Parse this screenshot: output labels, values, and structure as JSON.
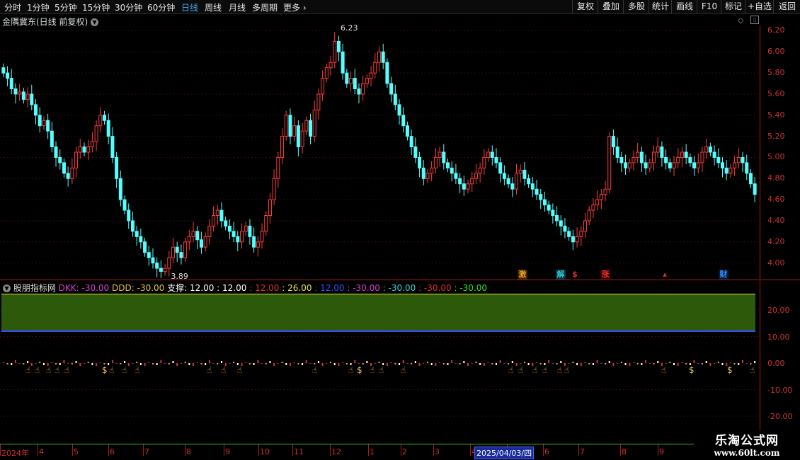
{
  "toolbar": {
    "timeframes": [
      {
        "label": "分时",
        "active": false
      },
      {
        "label": "1分钟",
        "active": false
      },
      {
        "label": "5分钟",
        "active": false
      },
      {
        "label": "15分钟",
        "active": false
      },
      {
        "label": "30分钟",
        "active": false
      },
      {
        "label": "60分钟",
        "active": false
      },
      {
        "label": "日线",
        "active": true
      },
      {
        "label": "周线",
        "active": false
      },
      {
        "label": "月线",
        "active": false
      },
      {
        "label": "多周期",
        "active": false
      },
      {
        "label": "更多",
        "active": false
      }
    ],
    "tools": [
      "复权",
      "叠加",
      "多股",
      "统计",
      "画线",
      "F10",
      "标记",
      "+自选",
      "返回"
    ]
  },
  "main_chart": {
    "title": "金隅冀东(日线 前复权)",
    "price_labels": [
      "6.20",
      "6.00",
      "5.80",
      "5.60",
      "5.40",
      "5.20",
      "5.00",
      "4.80",
      "4.60",
      "4.40",
      "4.20",
      "4.00"
    ],
    "high_marker": "6.23",
    "low_marker": "3.89",
    "events": [
      {
        "label": "激",
        "color": "#e8a020"
      },
      {
        "label": "解",
        "color": "#30c0d0"
      },
      {
        "label": "$",
        "color": "#e03030"
      },
      {
        "label": "涨",
        "color": "#e03030"
      },
      {
        "label": "▴",
        "color": "#e03030"
      },
      {
        "label": "财",
        "color": "#3090ff"
      }
    ]
  },
  "indicator": {
    "name": "股朋指标网",
    "legend": [
      {
        "text": "DKK: -30.00",
        "color": "#d040d0"
      },
      {
        "text": "DDD: -30.00",
        "color": "#e0c040"
      },
      {
        "text": "支撑: 12.00",
        "color": "#ffffff"
      },
      {
        "text": ": 12.00",
        "color": "#ffffff"
      },
      {
        "text": ": 12.00",
        "color": "#e03030"
      },
      {
        "text": ": 26.00",
        "color": "#e0e040"
      },
      {
        "text": ": 12.00",
        "color": "#3050ff"
      },
      {
        "text": ": -30.00",
        "color": "#d040d0"
      },
      {
        "text": ": -30.00",
        "color": "#30d0d0"
      },
      {
        "text": ": -30.00",
        "color": "#e03030"
      },
      {
        "text": ": -30.00",
        "color": "#30e030"
      }
    ],
    "axis_labels": [
      "20.00",
      "10.00",
      "0.00",
      "-10.00",
      "-20.00"
    ]
  },
  "date_axis": {
    "labels": [
      "2024年",
      "4",
      "5",
      "6",
      "7",
      "8",
      "9",
      "10",
      "11",
      "12",
      "1",
      "2",
      "3",
      "4",
      "5",
      "6",
      "7",
      "8",
      "9"
    ],
    "cursor_date": "2025/04/03/四"
  },
  "watermark": {
    "line1": "乐淘公式网",
    "line2": "www.60lt.com"
  },
  "chart_data": {
    "type": "candlestick",
    "title": "金隅冀东(日线 前复权)",
    "ylim": [
      3.85,
      6.25
    ],
    "ylabel": "",
    "x_start": "2024-03",
    "x_end": "2025-09",
    "close_series": [
      5.8,
      5.75,
      5.65,
      5.6,
      5.62,
      5.55,
      5.6,
      5.5,
      5.4,
      5.3,
      5.35,
      5.25,
      5.1,
      5.0,
      4.95,
      4.85,
      4.8,
      4.9,
      5.05,
      5.1,
      5.05,
      5.1,
      5.15,
      5.3,
      5.4,
      5.35,
      5.2,
      5.0,
      4.8,
      4.6,
      4.5,
      4.4,
      4.3,
      4.25,
      4.2,
      4.1,
      4.05,
      4.0,
      3.95,
      3.92,
      3.95,
      4.05,
      4.15,
      4.1,
      4.05,
      4.2,
      4.25,
      4.3,
      4.22,
      4.15,
      4.25,
      4.35,
      4.45,
      4.5,
      4.4,
      4.35,
      4.3,
      4.25,
      4.2,
      4.3,
      4.35,
      4.25,
      4.15,
      4.2,
      4.3,
      4.45,
      4.6,
      4.8,
      5.0,
      5.2,
      5.4,
      5.2,
      5.3,
      5.1,
      5.25,
      5.35,
      5.2,
      5.45,
      5.6,
      5.75,
      5.85,
      5.9,
      6.1,
      6.0,
      5.8,
      5.7,
      5.75,
      5.65,
      5.6,
      5.7,
      5.75,
      5.8,
      5.9,
      6.0,
      5.9,
      5.7,
      5.6,
      5.5,
      5.4,
      5.3,
      5.2,
      5.1,
      5.0,
      4.9,
      4.8,
      4.85,
      4.9,
      5.0,
      5.05,
      4.95,
      4.9,
      4.85,
      4.8,
      4.75,
      4.7,
      4.75,
      4.8,
      4.85,
      4.9,
      5.0,
      5.05,
      5.0,
      4.95,
      4.85,
      4.8,
      4.75,
      4.7,
      4.85,
      4.88,
      4.8,
      4.75,
      4.7,
      4.65,
      4.6,
      4.55,
      4.5,
      4.45,
      4.4,
      4.35,
      4.3,
      4.25,
      4.2,
      4.25,
      4.3,
      4.4,
      4.5,
      4.55,
      4.6,
      4.65,
      4.7,
      5.2,
      5.1,
      5.0,
      4.95,
      4.9,
      4.95,
      5.0,
      5.05,
      4.95,
      4.9,
      4.95,
      5.05,
      5.1,
      5.0,
      4.95,
      4.9,
      4.95,
      5.0,
      5.05,
      5.0,
      4.95,
      4.9,
      4.95,
      5.05,
      5.1,
      5.05,
      5.0,
      4.95,
      4.9,
      4.85,
      4.9,
      4.95,
      5.0,
      4.95,
      4.85,
      4.75,
      4.65
    ]
  }
}
